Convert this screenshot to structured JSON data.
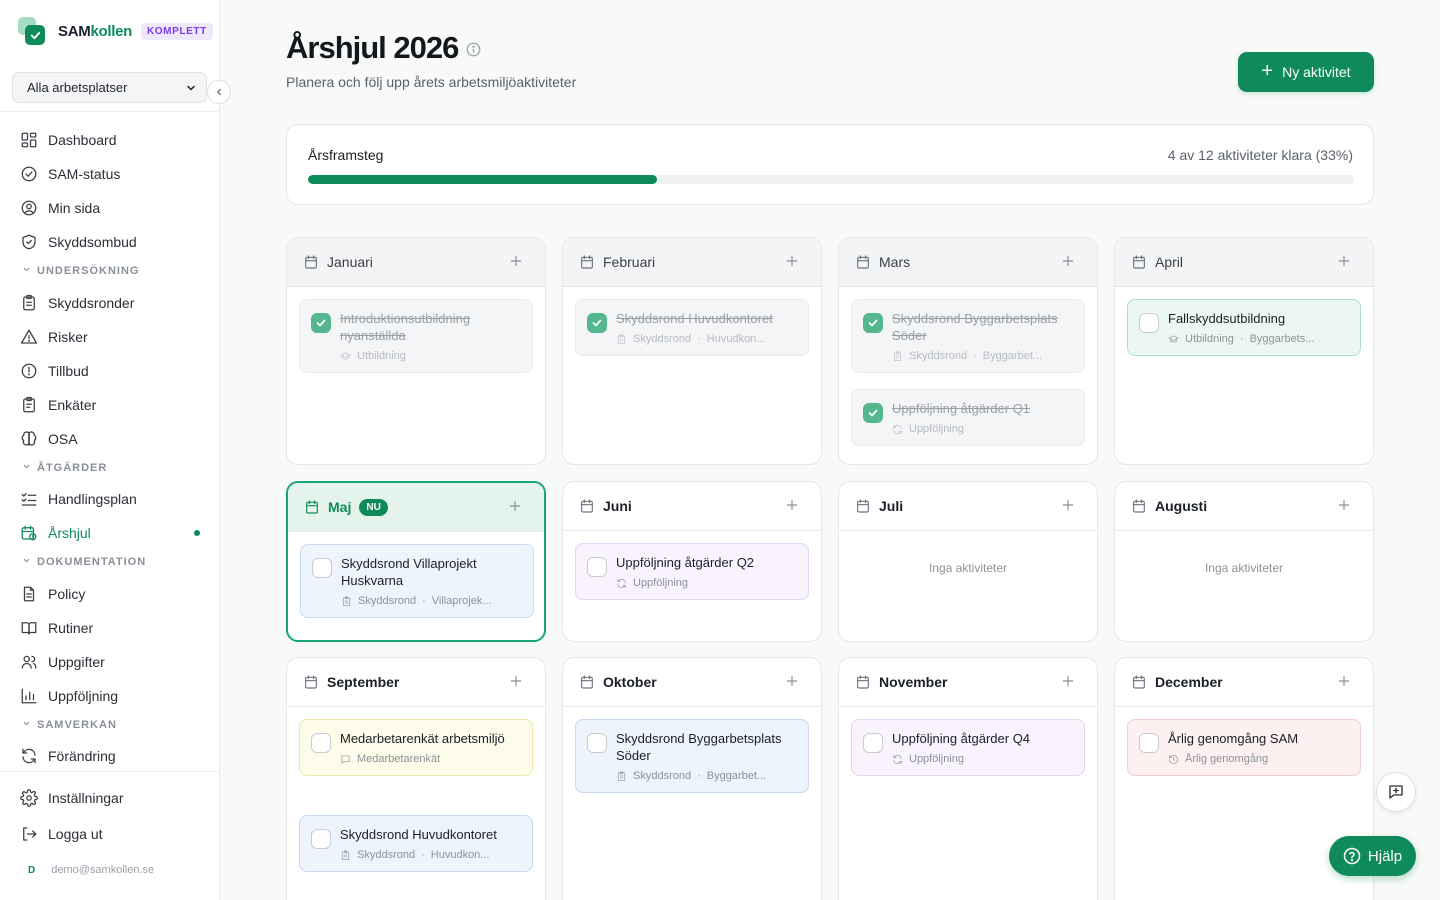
{
  "app": {
    "logo_part1": "SAM",
    "logo_part2": "kollen",
    "plan_badge": "KOMPLETT",
    "workplace_select": "Alla arbetsplatser",
    "brand_color": "#0f8a5a"
  },
  "sidebar": {
    "items": [
      {
        "label": "Dashboard",
        "icon": "dashboard-icon"
      },
      {
        "label": "SAM-status",
        "icon": "check-circle-icon"
      },
      {
        "label": "Min sida",
        "icon": "user-circle-icon"
      },
      {
        "label": "Skyddsombud",
        "icon": "shield-icon"
      }
    ],
    "sections": [
      {
        "title": "UNDERSÖKNING",
        "items": [
          {
            "label": "Skyddsronder",
            "icon": "clipboard-icon"
          },
          {
            "label": "Risker",
            "icon": "warning-triangle-icon"
          },
          {
            "label": "Tillbud",
            "icon": "alert-circle-icon"
          },
          {
            "label": "Enkäter",
            "icon": "survey-icon"
          },
          {
            "label": "OSA",
            "icon": "brain-icon"
          }
        ]
      },
      {
        "title": "ÅTGÄRDER",
        "items": [
          {
            "label": "Handlingsplan",
            "icon": "list-check-icon"
          },
          {
            "label": "Årshjul",
            "icon": "calendar-clock-icon",
            "active": true
          }
        ]
      },
      {
        "title": "DOKUMENTATION",
        "items": [
          {
            "label": "Policy",
            "icon": "document-icon"
          },
          {
            "label": "Rutiner",
            "icon": "book-icon"
          },
          {
            "label": "Uppgifter",
            "icon": "users-icon"
          },
          {
            "label": "Uppföljning",
            "icon": "bar-chart-icon"
          }
        ]
      },
      {
        "title": "SAMVERKAN",
        "items": [
          {
            "label": "Förändring",
            "icon": "refresh-icon"
          }
        ]
      }
    ],
    "bottom": [
      {
        "label": "Inställningar",
        "icon": "gear-icon"
      },
      {
        "label": "Logga ut",
        "icon": "logout-icon"
      }
    ],
    "user_initial": "D",
    "user_email": "demo@samkollen.se"
  },
  "header": {
    "title": "Årshjul 2026",
    "subtitle": "Planera och följ upp årets arbetsmiljöaktiviteter",
    "new_button": "Ny aktivitet"
  },
  "progress": {
    "label": "Årsframsteg",
    "status_text": "4 av 12 aktiviteter klara (33%)",
    "done": 4,
    "total": 12,
    "percent": 33
  },
  "months": [
    {
      "name": "Januari",
      "state": "past",
      "activities": [
        {
          "title": "Introduktionsutbildning nyanställda",
          "type": "Utbildning",
          "icon": "graduation-icon",
          "done": true
        }
      ]
    },
    {
      "name": "Februari",
      "state": "past",
      "activities": [
        {
          "title": "Skyddsrond Huvudkontoret",
          "type": "Skyddsrond",
          "place": "Huvudkon...",
          "icon": "clipboard-icon",
          "done": true
        }
      ]
    },
    {
      "name": "Mars",
      "state": "past",
      "activities": [
        {
          "title": "Skyddsrond Byggarbetsplats Söder",
          "type": "Skyddsrond",
          "place": "Byggarbet...",
          "icon": "clipboard-icon",
          "done": true
        },
        {
          "title": "Uppföljning åtgärder Q1",
          "type": "Uppföljning",
          "icon": "refresh-icon",
          "done": true
        }
      ]
    },
    {
      "name": "April",
      "state": "past",
      "activities": [
        {
          "title": "Fallskyddsutbildning",
          "type": "Utbildning",
          "place": "Byggarbets...",
          "icon": "graduation-icon",
          "done": false,
          "color": "green"
        }
      ]
    },
    {
      "name": "Maj",
      "state": "current",
      "badge": "NU",
      "activities": [
        {
          "title": "Skyddsrond Villaprojekt Huskvarna",
          "type": "Skyddsrond",
          "place": "Villaprojek...",
          "icon": "clipboard-icon",
          "done": false,
          "color": "blue"
        }
      ]
    },
    {
      "name": "Juni",
      "state": "future",
      "activities": [
        {
          "title": "Uppföljning åtgärder Q2",
          "type": "Uppföljning",
          "icon": "refresh-icon",
          "done": false,
          "color": "purple"
        }
      ]
    },
    {
      "name": "Juli",
      "state": "future",
      "empty_text": "Inga aktiviteter",
      "activities": []
    },
    {
      "name": "Augusti",
      "state": "future",
      "empty_text": "Inga aktiviteter",
      "activities": []
    },
    {
      "name": "September",
      "state": "future",
      "activities": [
        {
          "title": "Medarbetarenkät arbetsmiljö",
          "type": "Medarbetarenkät",
          "icon": "message-icon",
          "done": false,
          "color": "yellow"
        },
        {
          "title": "Skyddsrond Huvudkontoret",
          "type": "Skyddsrond",
          "place": "Huvudkon...",
          "icon": "clipboard-icon",
          "done": false,
          "color": "blue"
        }
      ]
    },
    {
      "name": "Oktober",
      "state": "future",
      "activities": [
        {
          "title": "Skyddsrond Byggarbetsplats Söder",
          "type": "Skyddsrond",
          "place": "Byggarbet...",
          "icon": "clipboard-icon",
          "done": false,
          "color": "blue"
        }
      ]
    },
    {
      "name": "November",
      "state": "future",
      "activities": [
        {
          "title": "Uppföljning åtgärder Q4",
          "type": "Uppföljning",
          "icon": "refresh-icon",
          "done": false,
          "color": "purple"
        }
      ]
    },
    {
      "name": "December",
      "state": "future",
      "activities": [
        {
          "title": "Årlig genomgång SAM",
          "type": "Årlig genomgång",
          "icon": "history-icon",
          "done": false,
          "color": "red"
        }
      ]
    }
  ],
  "floating": {
    "help_label": "Hjälp"
  }
}
